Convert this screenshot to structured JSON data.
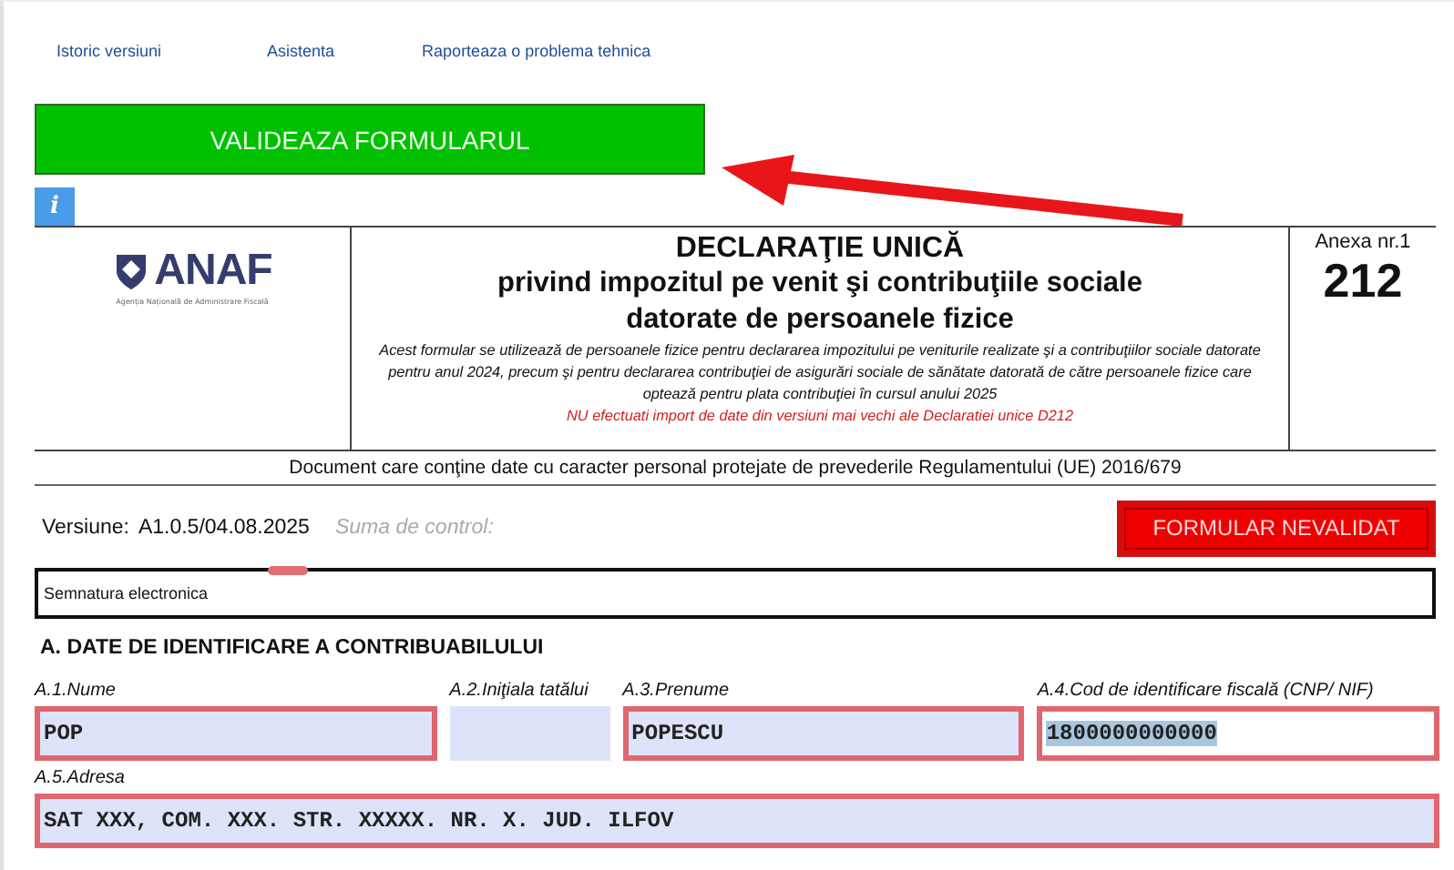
{
  "top_links": [
    "Istoric versiuni",
    "Asistenta",
    "Raporteaza o problema tehnica"
  ],
  "validate_button": "VALIDEAZA FORMULARUL",
  "info_button": "i",
  "header": {
    "logo_text": "ANAF",
    "logo_subtitle": "Agenția Națională de Administrare Fiscală",
    "title": "DECLARAŢIE UNICĂ",
    "subtitle_lines": [
      "privind impozitul pe venit şi contribuţiile sociale",
      "datorate de persoanele fizice"
    ],
    "description": "Acest formular se utilizează de persoanele fizice pentru declararea impozitului pe veniturile realizate şi a contribuţiilor sociale datorate pentru anul 2024, precum şi pentru declararea contribuţiei de asigurări sociale de sănătate datorată de către persoanele fizice care optează pentru plata contribuţiei în cursul anului 2025",
    "warning": "NU efectuati import de date din versiuni mai vechi ale Declaratiei unice D212",
    "annex_label": "Anexa nr.1",
    "form_number": "212"
  },
  "privacy_note": "Document care conţine date cu caracter personal protejate de prevederile Regulamentului (UE) 2016/679",
  "version": {
    "label": "Versiune:",
    "value": "A1.0.5/04.08.2025",
    "checksum_label": "Suma de control:"
  },
  "status_button": "FORMULAR NEVALIDAT",
  "signature": {
    "label": "Semnatura electronica"
  },
  "section_title": "A. DATE DE IDENTIFICARE A CONTRIBUABILULUI",
  "fields_row": [
    {
      "label": "A.1.Nume",
      "value": "POP",
      "invalid": true,
      "highlighted": false
    },
    {
      "label": "A.2.Iniţiala tatălui",
      "invalid": false,
      "highlighted": false
    },
    {
      "label": "A.3.Prenume",
      "value": "POPESCU",
      "invalid": true,
      "highlighted": false
    },
    {
      "label": "A.4.Cod de identificare fiscală (CNP/ NIF)",
      "value": "1800000000000",
      "invalid": true,
      "highlighted": true
    }
  ],
  "address": {
    "label": "A.5.Adresa",
    "value": "SAT XXX, COM. XXX. STR. XXXXX. NR. X. JUD. ILFOV",
    "invalid": true
  },
  "annotation": {
    "kind": "arrow"
  }
}
